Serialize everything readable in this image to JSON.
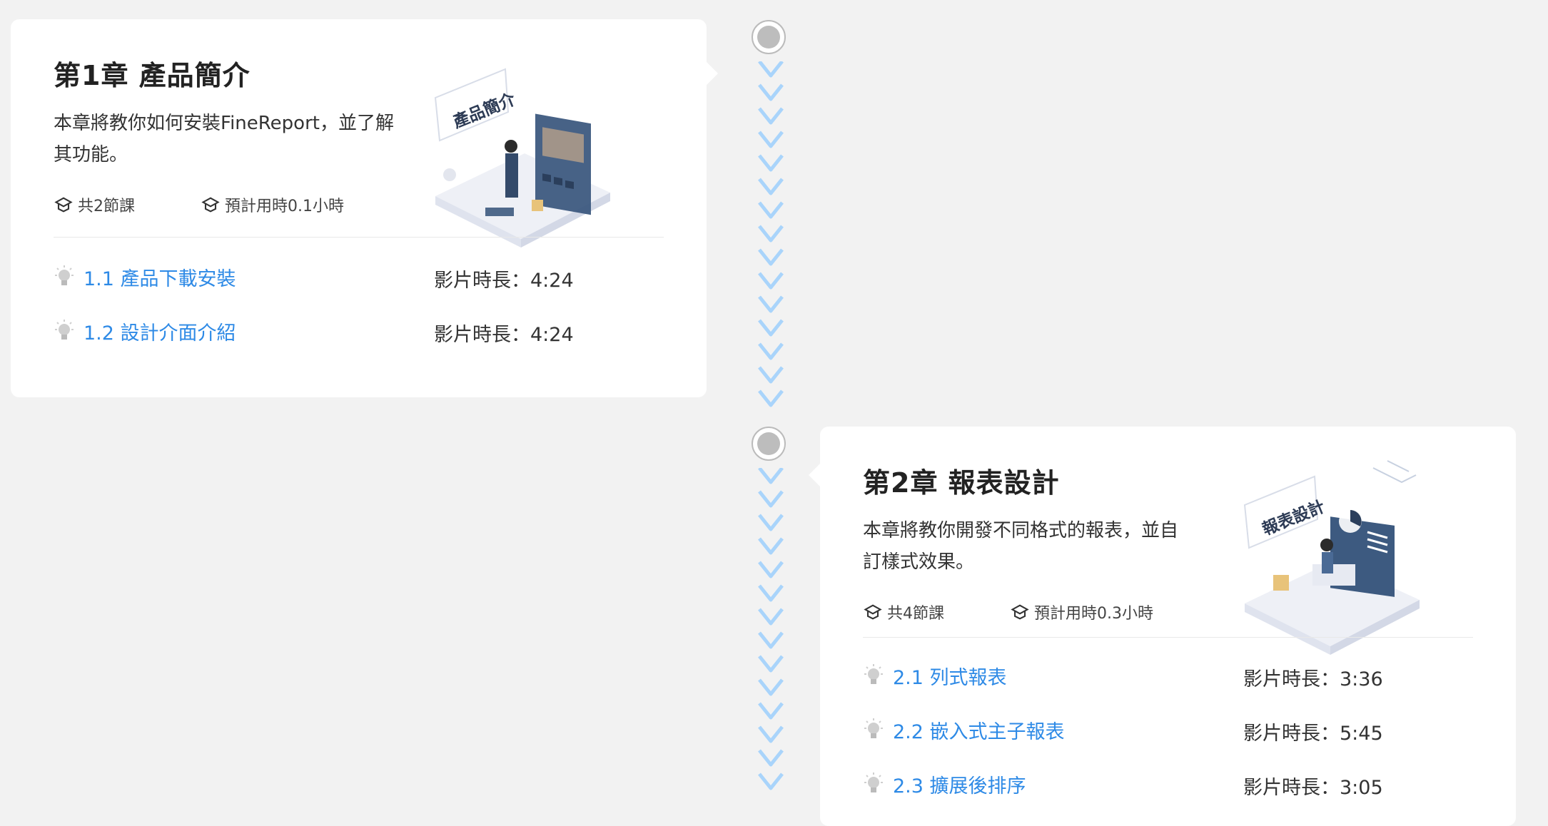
{
  "colors": {
    "link": "#2e8ae6",
    "chevron": "#a9d4fb",
    "node": "#bdbdbd",
    "background": "#f2f2f2"
  },
  "chapters": [
    {
      "title": "第1章 產品簡介",
      "desc_line1": "本章將教你如何安裝FineReport，並了解",
      "desc_line2": "其功能。",
      "lessons_count": "共2節課",
      "estimated_time": "預計用時0.1小時",
      "illustration_label": "產品簡介",
      "lessons": [
        {
          "title": "1.1 產品下載安裝",
          "duration": "影片時長：4:24"
        },
        {
          "title": "1.2 設計介面介紹",
          "duration": "影片時長：4:24"
        }
      ]
    },
    {
      "title": "第2章 報表設計",
      "desc_line1": "本章將教你開發不同格式的報表，並自",
      "desc_line2": "訂樣式效果。",
      "lessons_count": "共4節課",
      "estimated_time": "預計用時0.3小時",
      "illustration_label": "報表設計",
      "lessons": [
        {
          "title": "2.1 列式報表",
          "duration": "影片時長：3:36"
        },
        {
          "title": "2.2 嵌入式主子報表",
          "duration": "影片時長：5:45"
        },
        {
          "title": "2.3 擴展後排序",
          "duration": "影片時長：3:05"
        }
      ]
    }
  ],
  "icons": {
    "lesson": "lightbulb-icon",
    "meta": "graduation-cap-icon",
    "timeline": "timeline-node-icon"
  }
}
